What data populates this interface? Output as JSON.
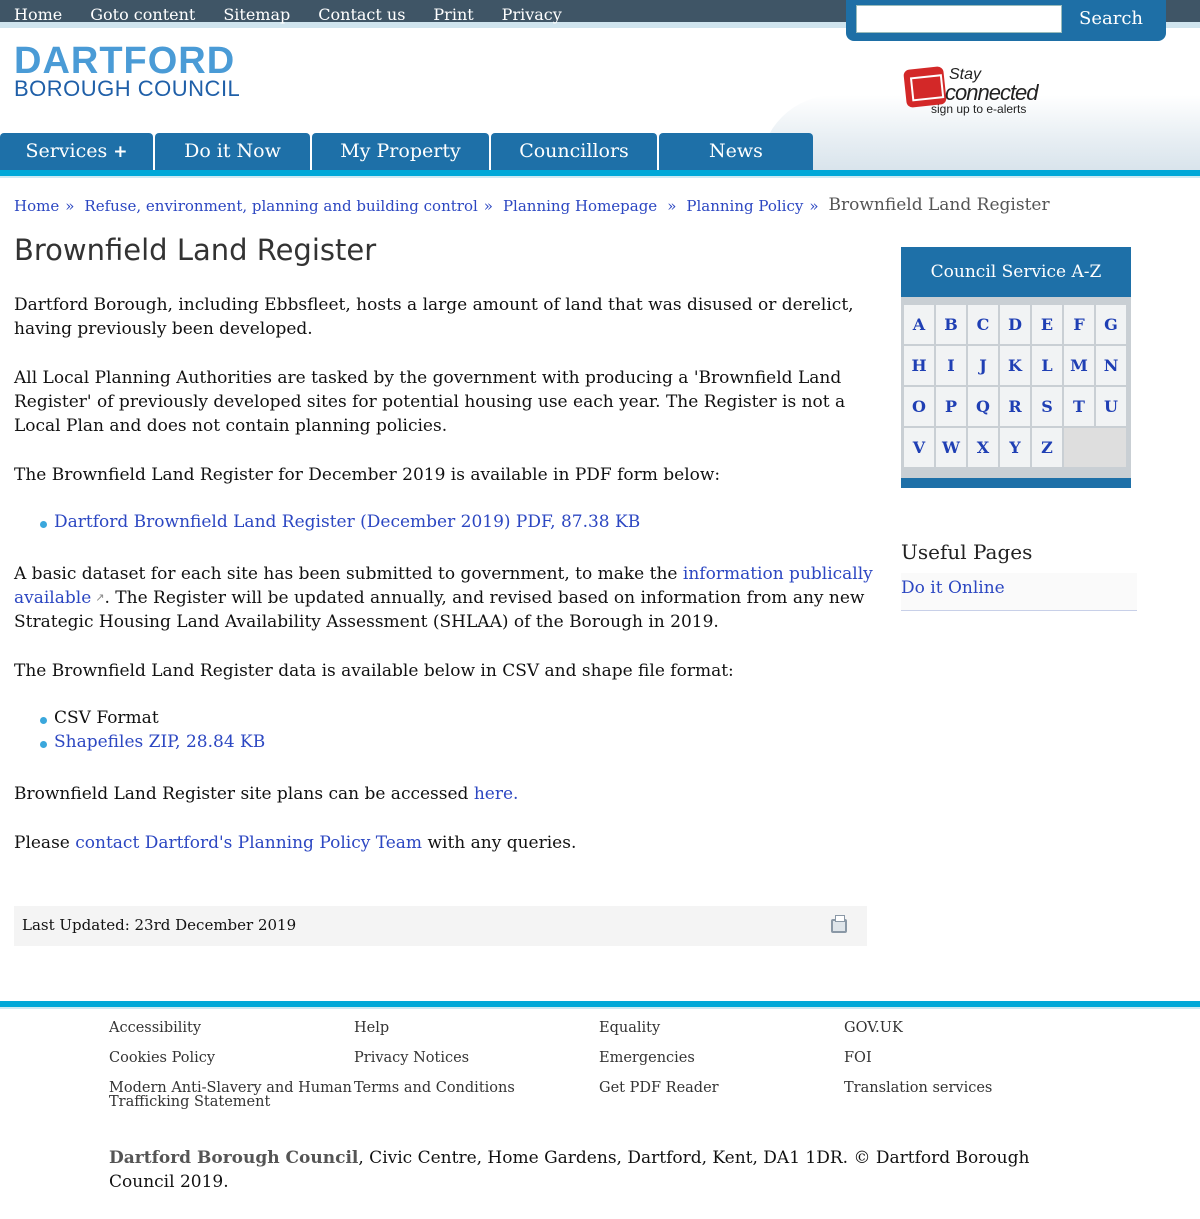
{
  "topnav": {
    "links": [
      "Home",
      "Goto content",
      "Sitemap",
      "Contact us",
      "Print",
      "Privacy"
    ],
    "search_button": "Search"
  },
  "logo": {
    "line1": "DARTFORD",
    "line2": "BOROUGH COUNCIL"
  },
  "stay_connected": {
    "line1": "Stay",
    "line2": "connected",
    "line3": "sign up to e-alerts"
  },
  "mainnav": {
    "items": [
      "Services",
      "Do it Now",
      "My Property",
      "Councillors",
      "News"
    ],
    "services_plus": "+"
  },
  "breadcrumb": {
    "links": [
      "Home",
      "Refuse, environment, planning and building control",
      "Planning Homepage",
      "Planning Policy"
    ],
    "separator": "»",
    "current": "Brownfield Land Register"
  },
  "page": {
    "title": "Brownfield Land Register",
    "p1": "Dartford Borough, including Ebbsfleet, hosts a large amount of land that was disused or derelict, having previously been developed.",
    "p2": "All Local Planning Authorities are tasked by the government with producing a 'Brownfield Land Register' of previously developed sites for potential housing use each year. The Register is not a Local Plan and does not contain planning policies.",
    "p3": "The Brownfield Land Register for December 2019 is available in PDF form below:",
    "pdf_link": "Dartford Brownfield Land Register (December 2019)  PDF, 87.38 KB",
    "p4_before": "A basic dataset for each site has been submitted to government, to make the ",
    "p4_link": "information publically available",
    "p4_after": ". The Register will be updated annually, and revised based on information from any new Strategic Housing Land Availability Assessment (SHLAA) of the Borough in 2019.",
    "p5": "The Brownfield Land Register data is available below in CSV and shape file format:",
    "csv_item": "CSV Format",
    "shape_link": "Shapefiles ZIP, 28.84 KB",
    "p6_before": "Brownfield Land Register site plans can be accessed ",
    "p6_link": "here.",
    "p7_before": "Please ",
    "p7_link": "contact Dartford's Planning Policy Team",
    "p7_after": " with any queries.",
    "last_updated": "Last Updated: 23rd December 2019"
  },
  "az": {
    "title": "Council Service A-Z",
    "letters": [
      "A",
      "B",
      "C",
      "D",
      "E",
      "F",
      "G",
      "H",
      "I",
      "J",
      "K",
      "L",
      "M",
      "N",
      "O",
      "P",
      "Q",
      "R",
      "S",
      "T",
      "U",
      "V",
      "W",
      "X",
      "Y",
      "Z"
    ]
  },
  "useful": {
    "title": "Useful Pages",
    "items": [
      "Do it Online"
    ]
  },
  "footer": {
    "col1": [
      "Accessibility",
      "Cookies Policy",
      "Modern Anti-Slavery and Human Trafficking Statement"
    ],
    "col2": [
      "Help",
      "Privacy Notices",
      "Terms and Conditions"
    ],
    "col3": [
      "Equality",
      "Emergencies",
      "Get PDF Reader"
    ],
    "col4": [
      "GOV.UK",
      "FOI",
      "Translation services"
    ],
    "org": "Dartford Borough Council",
    "address": ", Civic Centre, Home Gardens, Dartford, Kent, DA1 1DR. © Dartford Borough Council 2019."
  }
}
